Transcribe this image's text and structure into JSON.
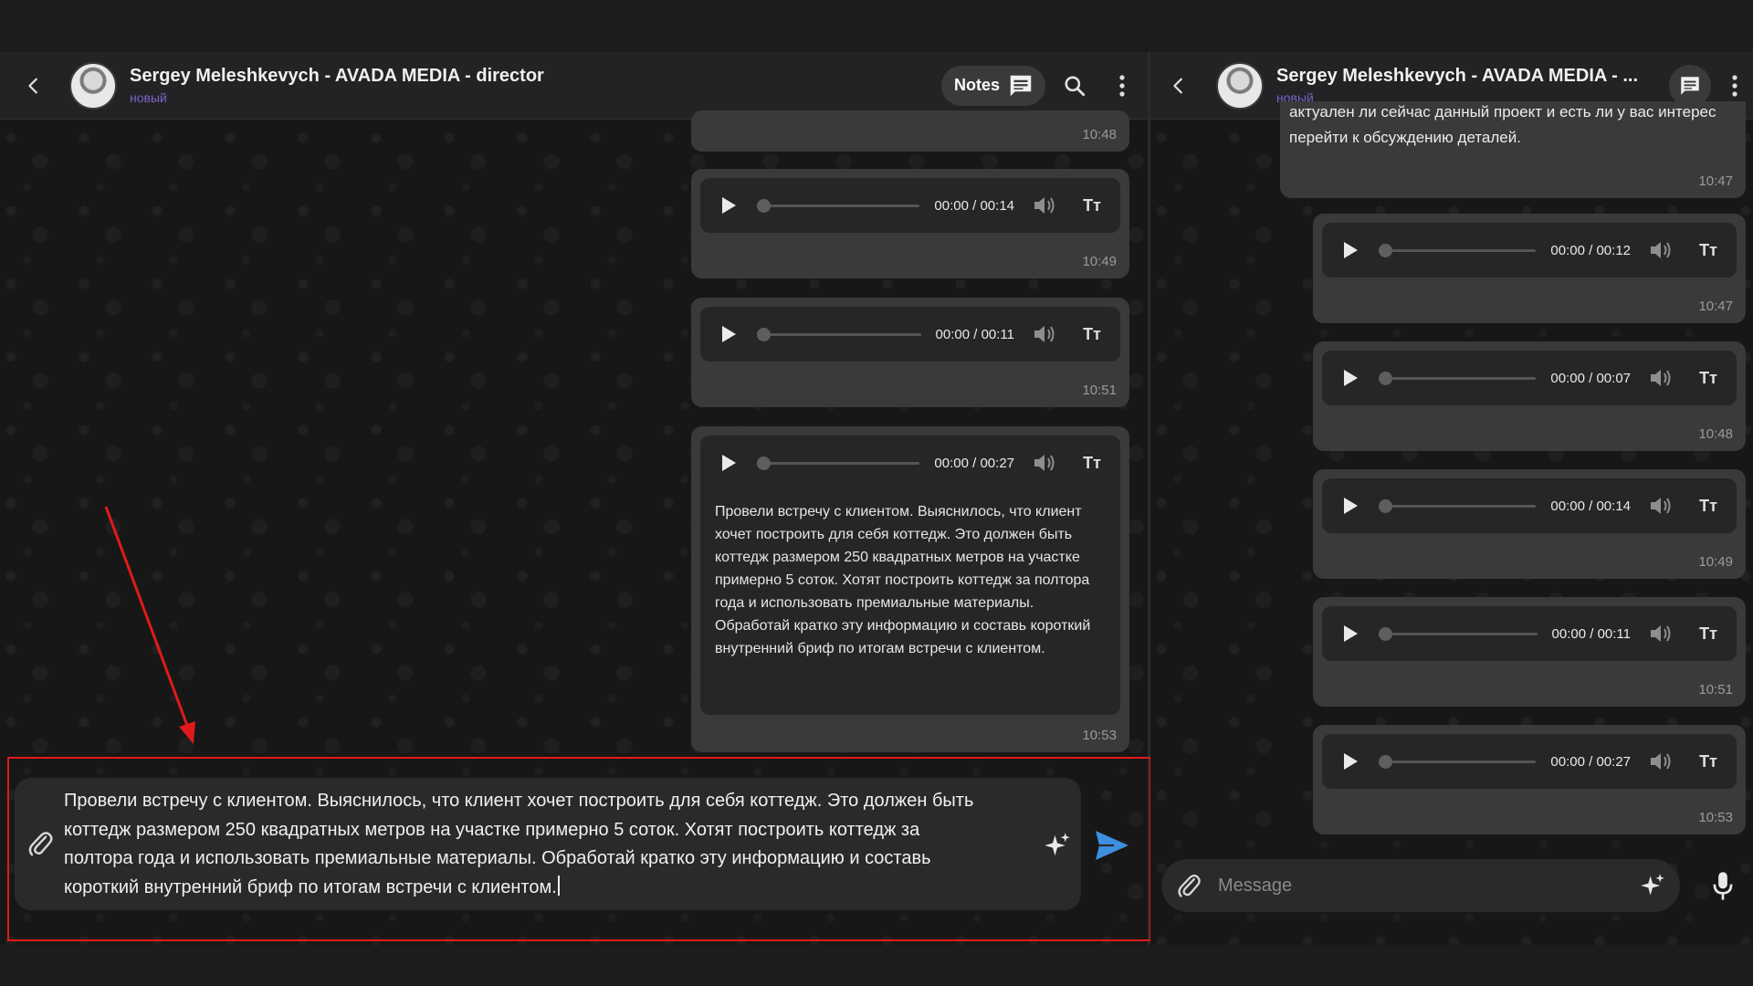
{
  "left_chat": {
    "title": "Sergey Meleshkevych - AVADA MEDIA - director",
    "status": "новый",
    "notes_label": "Notes",
    "top_time": "10:48",
    "audio_messages": [
      {
        "time_display": "00:00 / 00:14",
        "sent_time": "10:49"
      },
      {
        "time_display": "00:00 / 00:11",
        "sent_time": "10:51"
      }
    ],
    "transcribed_message": {
      "time_display": "00:00 / 00:27",
      "text": "Провели встречу с клиентом. Выяснилось, что клиент хочет построить для себя коттедж. Это должен быть коттедж размером 250 квадратных метров на участке примерно 5 соток. Хотят построить коттедж за полтора года и использовать премиальные материалы. Обработай кратко эту информацию и составь короткий внутренний бриф по итогам встречи с клиентом.",
      "sent_time": "10:53"
    },
    "composer_text": "Провели встречу с клиентом. Выяснилось, что клиент хочет построить для себя коттедж. Это должен быть коттедж размером 250 квадратных метров на участке примерно 5 соток. Хотят построить коттедж за полтора года и использовать премиальные материалы. Обработай кратко эту информацию и составь короткий внутренний бриф по итогам встречи с клиентом."
  },
  "right_chat": {
    "title": "Sergey Meleshkevych - AVADA MEDIA - ...",
    "status": "новый",
    "text_message": {
      "text": "актуален ли сейчас данный проект и есть ли у вас интерес перейти к обсуждению деталей.",
      "sent_time": "10:47"
    },
    "audio_messages": [
      {
        "time_display": "00:00 / 00:12",
        "sent_time": "10:47"
      },
      {
        "time_display": "00:00 / 00:07",
        "sent_time": "10:48"
      },
      {
        "time_display": "00:00 / 00:14",
        "sent_time": "10:49"
      },
      {
        "time_display": "00:00 / 00:11",
        "sent_time": "10:51"
      },
      {
        "time_display": "00:00 / 00:27",
        "sent_time": "10:53"
      }
    ],
    "composer_placeholder": "Message"
  },
  "tt_label": "Tт",
  "colors": {
    "accent_status": "#7b62c9",
    "send_blue": "#3d8fe0",
    "highlight_red": "#e01a1a"
  },
  "icons": [
    "back-arrow-icon",
    "notes-icon",
    "search-icon",
    "more-vertical-icon",
    "play-icon",
    "volume-icon",
    "text-size-icon",
    "paperclip-icon",
    "sparkle-icon",
    "send-icon",
    "microphone-icon",
    "chat-icon"
  ]
}
